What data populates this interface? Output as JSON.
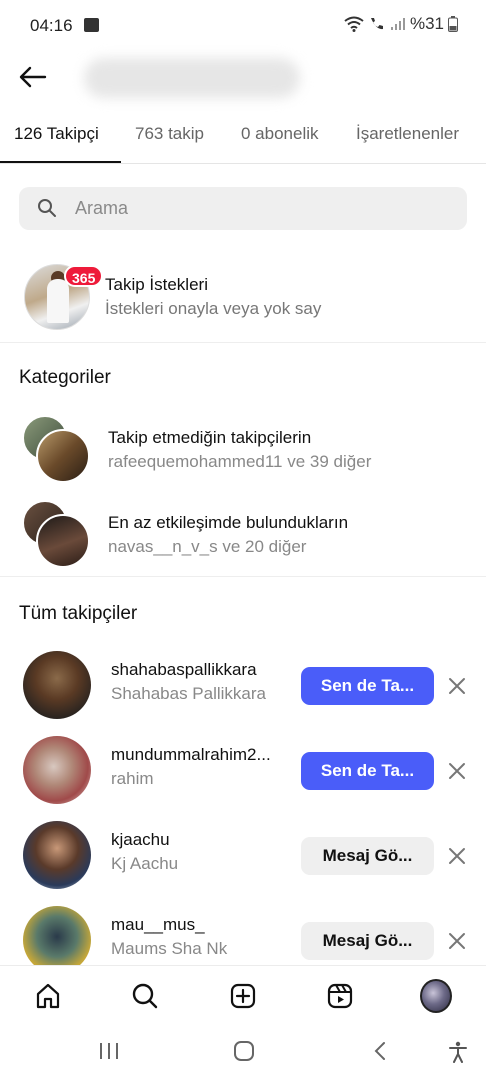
{
  "status": {
    "time": "04:16",
    "battery": "%31"
  },
  "tabs": [
    {
      "label": "126 Takipçi"
    },
    {
      "label": "763 takip"
    },
    {
      "label": "0 abonelik"
    },
    {
      "label": "İşaretlenenler"
    }
  ],
  "search": {
    "placeholder": "Arama"
  },
  "requests": {
    "badge": "365",
    "title": "Takip İstekleri",
    "subtitle": "İstekleri onayla veya yok say"
  },
  "categories": {
    "heading": "Kategoriler",
    "items": [
      {
        "title": "Takip etmediğin takipçilerin",
        "subtitle": "rafeequemohammed11 ve 39 diğer"
      },
      {
        "title": "En az etkileşimde bulundukların",
        "subtitle": "navas__n_v_s ve 20 diğer"
      }
    ]
  },
  "followers": {
    "heading": "Tüm takipçiler",
    "items": [
      {
        "username": "shahabaspallikkara",
        "name": "Shahabas Pallikkara",
        "button": "Sen de Ta...",
        "style": "primary"
      },
      {
        "username": "mundummalrahim2...",
        "name": "rahim",
        "button": "Sen de Ta...",
        "style": "primary"
      },
      {
        "username": "kjaachu",
        "name": "Kj Aachu",
        "button": "Mesaj Gö...",
        "style": "secondary"
      },
      {
        "username": "mau__mus_",
        "name": "Maums Sha Nk",
        "button": "Mesaj Gö...",
        "style": "secondary"
      }
    ]
  },
  "colors": {
    "primary_button": "#4a5df9",
    "badge": "#ee1b3a"
  },
  "icons": {
    "bottom_nav": [
      "home-icon",
      "search-icon",
      "create-icon",
      "reels-icon",
      "profile-avatar"
    ],
    "system_nav": [
      "recents-icon",
      "home-circle-icon",
      "back-chevron-icon",
      "accessibility-icon"
    ]
  }
}
